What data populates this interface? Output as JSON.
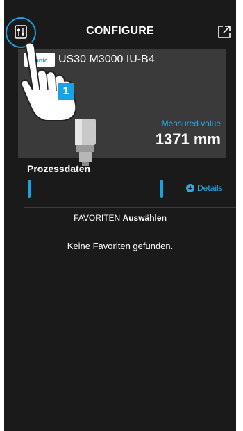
{
  "header": {
    "title": "CONFIGURE",
    "left_icon": "settings-sliders-icon",
    "right_icon": "open-external-icon"
  },
  "device": {
    "logo_text": "sonic",
    "name": "US30 M3000 IU-B4",
    "measured_label": "Measured value",
    "measured_value": "1371 mm"
  },
  "tutorial": {
    "step": "1"
  },
  "process": {
    "title": "Prozessdaten",
    "details_label": "Details"
  },
  "favorites": {
    "label": "FAVORITEN",
    "action": "Auswählen",
    "empty_message": "Keine Favoriten gefunden."
  },
  "colors": {
    "accent": "#1aa3e4",
    "background": "#1a1a1a",
    "card": "#3a3a3a"
  }
}
